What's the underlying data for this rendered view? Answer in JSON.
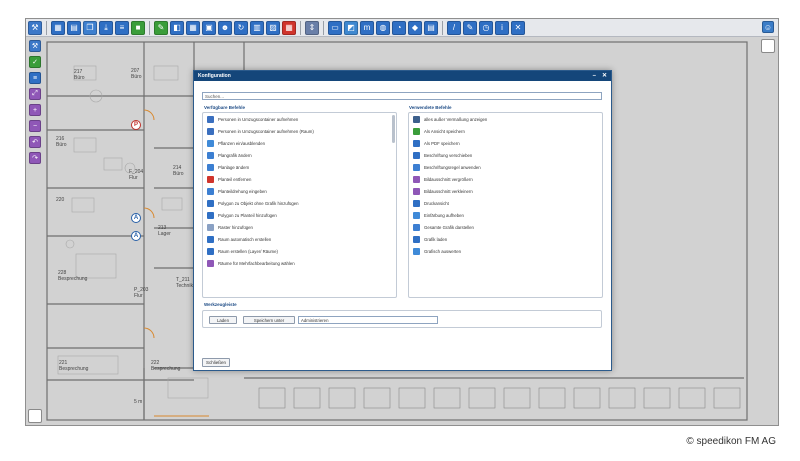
{
  "toolbar": {
    "groups": [
      [
        {
          "icon": "wrench-icon",
          "color": "#3c78c8",
          "glyph": "⚒"
        }
      ],
      [
        {
          "icon": "grid-icon",
          "color": "#2f6fc4",
          "glyph": "▦"
        },
        {
          "icon": "table-icon",
          "color": "#2f6fc4",
          "glyph": "▤"
        },
        {
          "icon": "copy-icon",
          "color": "#3d7fcf",
          "glyph": "❐"
        },
        {
          "icon": "pdf-icon",
          "color": "#2f6fc4",
          "glyph": "⤓"
        },
        {
          "icon": "list-icon",
          "color": "#2f6fc4",
          "glyph": "≡"
        },
        {
          "icon": "save-icon",
          "color": "#3a9d3a",
          "glyph": "■"
        }
      ],
      [
        {
          "icon": "edit-icon",
          "color": "#3a9d3a",
          "glyph": "✎"
        },
        {
          "icon": "layers-icon",
          "color": "#2f6fc4",
          "glyph": "◧"
        },
        {
          "icon": "grid2-icon",
          "color": "#2f6fc4",
          "glyph": "▦"
        },
        {
          "icon": "image-icon",
          "color": "#2f6fc4",
          "glyph": "▣"
        },
        {
          "icon": "people-icon",
          "color": "#2f6fc4",
          "glyph": "☻"
        },
        {
          "icon": "refresh-icon",
          "color": "#2f6fc4",
          "glyph": "↻"
        },
        {
          "icon": "report-icon",
          "color": "#2f6fc4",
          "glyph": "▥"
        },
        {
          "icon": "stamp-icon",
          "color": "#2f6fc4",
          "glyph": "▨"
        },
        {
          "icon": "calendar-icon",
          "color": "#d0342c",
          "glyph": "▦"
        }
      ],
      [
        {
          "icon": "fit-icon",
          "color": "#6a7fa8",
          "glyph": "⇕"
        }
      ],
      [
        {
          "icon": "monitor-icon",
          "color": "#2f6fc4",
          "glyph": "▭"
        },
        {
          "icon": "image2-icon",
          "color": "#3e88d0",
          "glyph": "◩"
        },
        {
          "icon": "area-icon",
          "color": "#2f6fc4",
          "glyph": "m"
        },
        {
          "icon": "globe-icon",
          "color": "#2f6fc4",
          "glyph": "◍"
        },
        {
          "icon": "chart-icon",
          "color": "#2f6fc4",
          "glyph": "◔"
        },
        {
          "icon": "tag-icon",
          "color": "#2f6fc4",
          "glyph": "◆"
        },
        {
          "icon": "stack-icon",
          "color": "#2f6fc4",
          "glyph": "▤"
        }
      ],
      [
        {
          "icon": "ruler-icon",
          "color": "#2f6fc4",
          "glyph": "/"
        },
        {
          "icon": "pencil-icon",
          "color": "#2f6fc4",
          "glyph": "✎"
        },
        {
          "icon": "clock-icon",
          "color": "#2f6fc4",
          "glyph": "◷"
        },
        {
          "icon": "info-icon",
          "color": "#2f6fc4",
          "glyph": "i"
        },
        {
          "icon": "close-icon",
          "color": "#2f6fc4",
          "glyph": "✕"
        }
      ]
    ]
  },
  "left_tools": [
    {
      "icon": "wrench-icon",
      "color": "#3c78c8",
      "glyph": "⚒"
    },
    {
      "icon": "checklist-icon",
      "color": "#3a9d3a",
      "glyph": "✓"
    },
    {
      "icon": "list-icon",
      "color": "#2f6fc4",
      "glyph": "≡"
    },
    {
      "icon": "zoom-box-icon",
      "color": "#8f57b7",
      "glyph": "⤢"
    },
    {
      "icon": "zoom-in-icon",
      "color": "#8f57b7",
      "glyph": "+"
    },
    {
      "icon": "zoom-out-icon",
      "color": "#8f57b7",
      "glyph": "−"
    },
    {
      "icon": "undo-icon",
      "color": "#8f57b7",
      "glyph": "↶"
    },
    {
      "icon": "redo-icon",
      "color": "#8f57b7",
      "glyph": "↷"
    }
  ],
  "plan": {
    "rooms": [
      {
        "number": "217",
        "name": "Büro"
      },
      {
        "number": "207",
        "name": "Büro"
      },
      {
        "number": "216",
        "name": "Büro"
      },
      {
        "number": "214",
        "name": "Büro"
      },
      {
        "number": "F_204",
        "name": "Flur"
      },
      {
        "number": "213",
        "name": "Lager"
      },
      {
        "number": "220",
        "name": ""
      },
      {
        "number": "228",
        "name": "Besprechung"
      },
      {
        "number": "T_211",
        "name": "Technik"
      },
      {
        "number": "P_203",
        "name": "Flur"
      },
      {
        "number": "221",
        "name": "Besprechung"
      },
      {
        "number": "222",
        "name": "Besprechung"
      }
    ],
    "markers": [
      "P",
      "A",
      "A"
    ],
    "scale_label": "5 m"
  },
  "dialog": {
    "title": "Konfiguration",
    "search_placeholder": "Suchen...",
    "available_title": "Verfügbare Befehle",
    "used_title": "Verwendete Befehle",
    "available": [
      {
        "label": "Personen in Umzugscontainer aufnehmen",
        "color": "#3a6fbf"
      },
      {
        "label": "Personen in Umzugscontainer aufnehmen (Raum)",
        "color": "#3a6fbf"
      },
      {
        "label": "Pflanzen ein/ausblenden",
        "color": "#3f8ad8"
      },
      {
        "label": "Plangrafik ändern",
        "color": "#3c7fd2"
      },
      {
        "label": "Planlage ändern",
        "color": "#3c7fd2"
      },
      {
        "label": "Planteil entfernen",
        "color": "#d0342c"
      },
      {
        "label": "Planteildrehung eingeben",
        "color": "#3c7fd2"
      },
      {
        "label": "Polygon zu Objekt ohne Grafik hinzufügen",
        "color": "#2f6fc4"
      },
      {
        "label": "Polygon zu Planteil hinzufügen",
        "color": "#2f6fc4"
      },
      {
        "label": "Raster hinzufügen",
        "color": "#8aa1c4"
      },
      {
        "label": "Raum automatisch erstellen",
        "color": "#2f6fc4"
      },
      {
        "label": "Raum erstellen (Layer/ Räume)",
        "color": "#2f6fc4"
      },
      {
        "label": "Räume für Mehrfachbearbeitung wählen",
        "color": "#8f57b7"
      }
    ],
    "used": [
      {
        "label": "alles außer Vermaßung anzeigen",
        "color": "#3c5f8c"
      },
      {
        "label": "Als Ansicht speichern",
        "color": "#3a9d3a"
      },
      {
        "label": "Als PDF speichern",
        "color": "#2f6fc4"
      },
      {
        "label": "Beschriftung verschieben",
        "color": "#2f6fc4"
      },
      {
        "label": "Beschriftungsregel anwenden",
        "color": "#3c7fd2"
      },
      {
        "label": "Bildausschnitt vergrößern",
        "color": "#8f57b7"
      },
      {
        "label": "Bildausschnitt verkleinern",
        "color": "#8f57b7"
      },
      {
        "label": "Druckansicht",
        "color": "#2f6fc4"
      },
      {
        "label": "Einfärbung aufheben",
        "color": "#3f8ad8"
      },
      {
        "label": "Gesamte Grafik darstellen",
        "color": "#3c7fd2"
      },
      {
        "label": "Grafik laden",
        "color": "#2f6fc4"
      },
      {
        "label": "Grafisch auswerten",
        "color": "#3f8ad8"
      }
    ],
    "workspace_title": "Werkzeugleiste",
    "load_label": "Laden",
    "save_as_label": "Speichern unter",
    "workspace_value": "Administrieren",
    "close_label": "Schließen"
  },
  "copyright": "© speedikon FM AG"
}
